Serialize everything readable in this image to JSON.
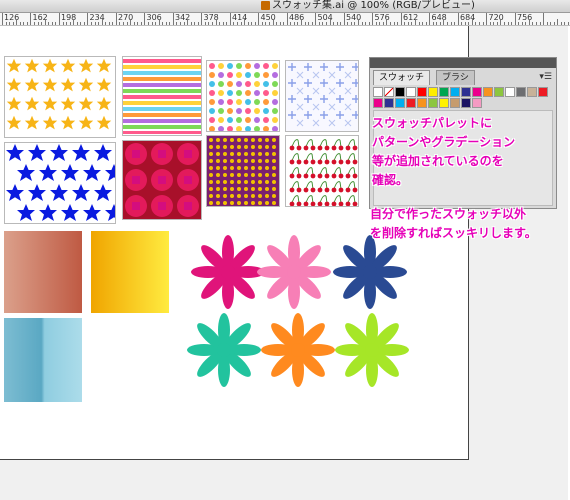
{
  "window": {
    "title": "スウォッチ集.ai @ 100% (RGB/プレビュー)",
    "app_icon_label": "Ai"
  },
  "ruler": {
    "ticks": [
      "126",
      "162",
      "198",
      "234",
      "270",
      "306",
      "342",
      "378",
      "414",
      "450",
      "486",
      "504",
      "540",
      "576",
      "612",
      "648",
      "684",
      "720",
      "756"
    ]
  },
  "swatches_panel": {
    "tabs": [
      "スウォッチ",
      "ブラシ"
    ],
    "active_tab": "スウォッチ",
    "menu_icon": "panel-menu-icon"
  },
  "annotations": {
    "first": [
      "スウォッチパレットに",
      "パターンやグラデーション",
      "等が追加されているのを",
      "確認。"
    ],
    "second": [
      "自分で作ったスウォッチ以外",
      "を削除すればスッキリします。"
    ]
  },
  "colors": {
    "annotation_text": "#e600b8",
    "flowers": [
      "#e0147a",
      "#f77fb6",
      "#2a4a93",
      "#22c39e",
      "#ff8a1f",
      "#a6e627"
    ],
    "gradients": {
      "salmon": [
        "#d49078",
        "#c05a40"
      ],
      "yellow": [
        "#f2a800",
        "#ffe93b"
      ],
      "blue": [
        "#6ab5cf",
        "#a4d9e8"
      ]
    }
  }
}
